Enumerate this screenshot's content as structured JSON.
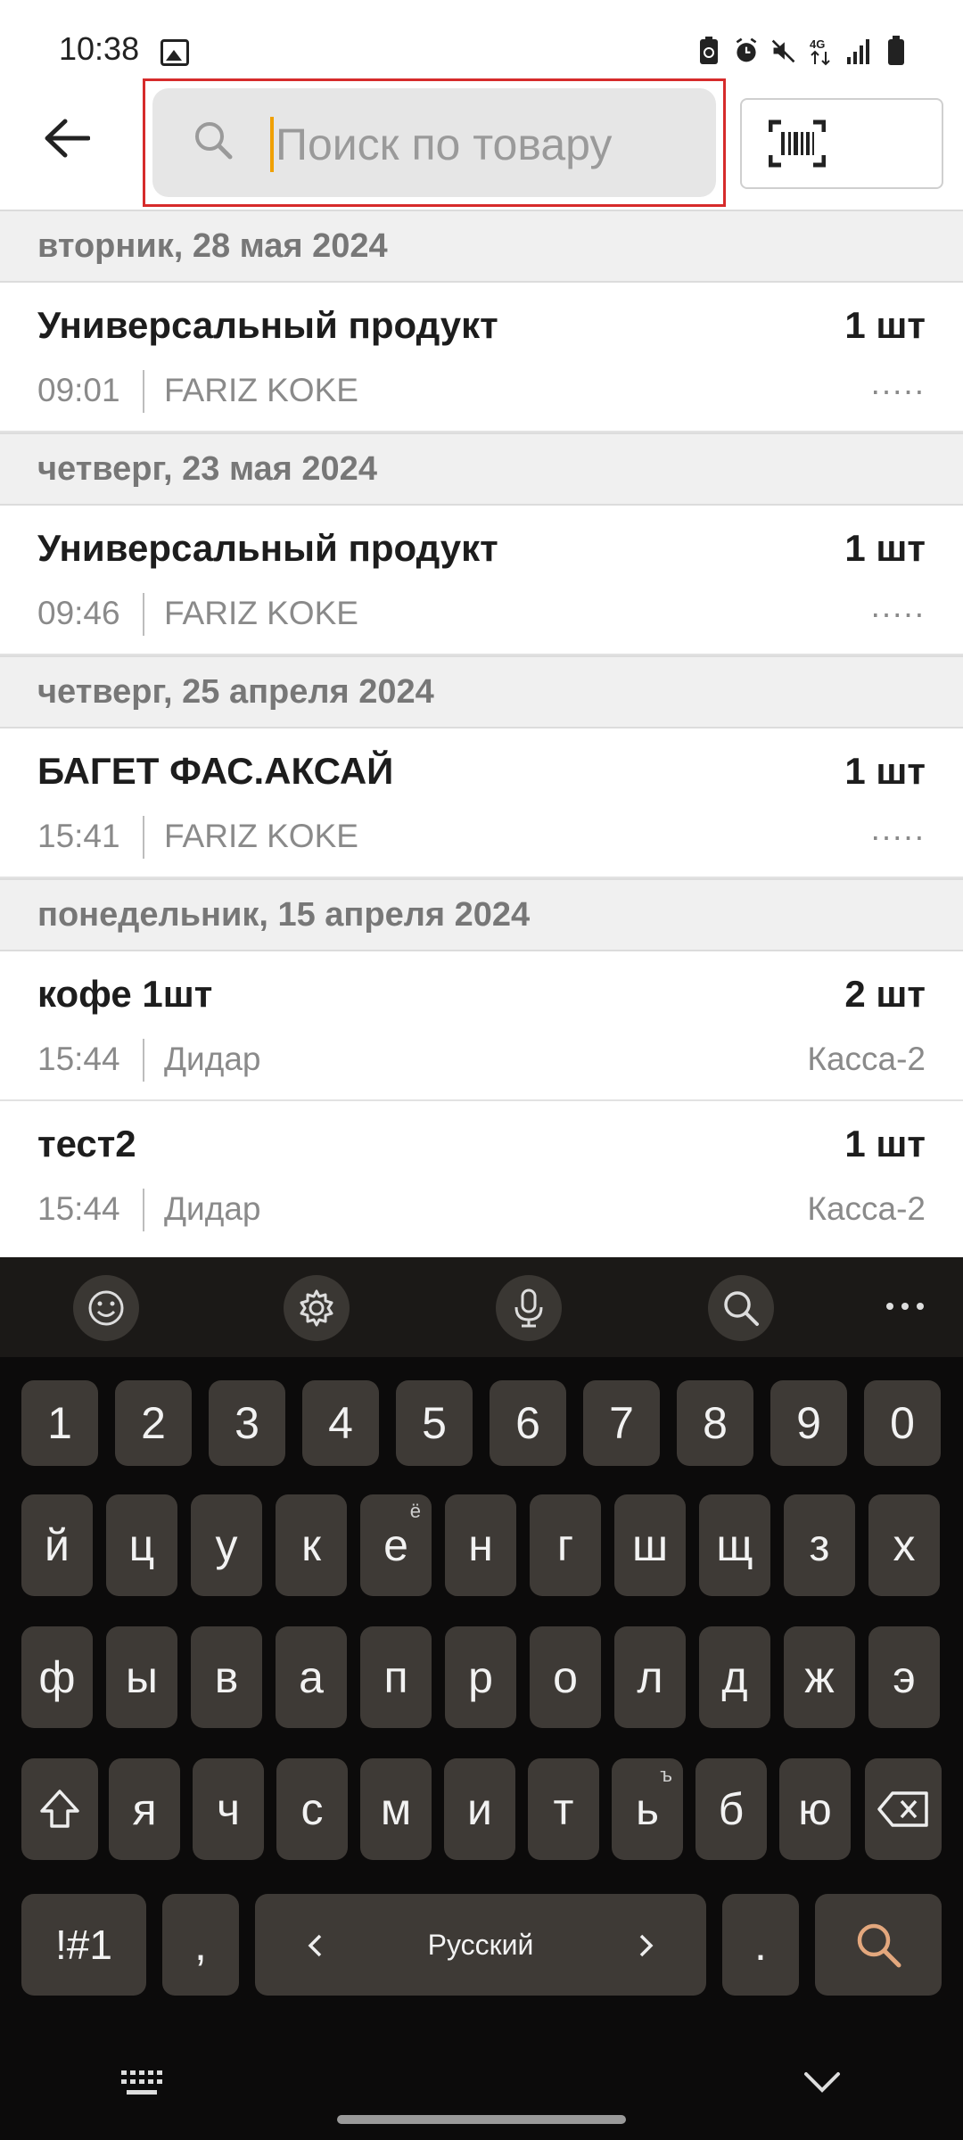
{
  "status_bar": {
    "time": "10:38"
  },
  "search": {
    "placeholder": "Поиск по товару"
  },
  "groups": [
    {
      "date": "вторник, 28 мая 2024",
      "items": [
        {
          "name": "Универсальный продукт",
          "qty": "1 шт",
          "time": "09:01",
          "user": "FARIZ KOKE",
          "register": "....."
        }
      ]
    },
    {
      "date": "четверг, 23 мая 2024",
      "items": [
        {
          "name": "Универсальный продукт",
          "qty": "1 шт",
          "time": "09:46",
          "user": "FARIZ KOKE",
          "register": "....."
        }
      ]
    },
    {
      "date": "четверг, 25 апреля 2024",
      "items": [
        {
          "name": "БАГЕТ ФАС.АКСАЙ",
          "qty": "1 шт",
          "time": "15:41",
          "user": "FARIZ KOKE",
          "register": "....."
        }
      ]
    },
    {
      "date": "понедельник, 15 апреля 2024",
      "items": [
        {
          "name": "кофе 1шт",
          "qty": "2 шт",
          "time": "15:44",
          "user": "Дидар",
          "register": "Касса-2"
        },
        {
          "name": "тест2",
          "qty": "1 шт",
          "time": "15:44",
          "user": "Дидар",
          "register": "Касса-2"
        }
      ]
    }
  ],
  "keyboard": {
    "number_row": [
      "1",
      "2",
      "3",
      "4",
      "5",
      "6",
      "7",
      "8",
      "9",
      "0"
    ],
    "row1": [
      "й",
      "ц",
      "у",
      "к",
      "е",
      "н",
      "г",
      "ш",
      "щ",
      "з",
      "х"
    ],
    "row1_sup": {
      "e_index": 4,
      "e_sup": "ё"
    },
    "row2": [
      "ф",
      "ы",
      "в",
      "а",
      "п",
      "р",
      "о",
      "л",
      "д",
      "ж",
      "э"
    ],
    "row3": [
      "я",
      "ч",
      "с",
      "м",
      "и",
      "т",
      "ь",
      "б",
      "ю"
    ],
    "row3_sup": {
      "soft_sign_sup": "ъ"
    },
    "symbols_label": "!#1",
    "comma_label": ",",
    "space_label": "Русский",
    "period_label": "."
  }
}
